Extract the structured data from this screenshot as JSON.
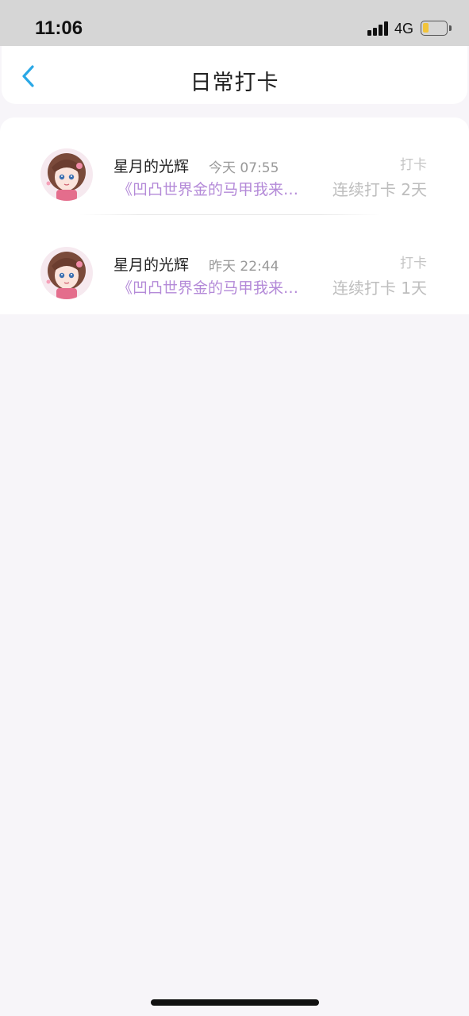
{
  "status_bar": {
    "time": "11:06",
    "network": "4G",
    "battery_level": 0.25,
    "battery_color": "#f2c43a"
  },
  "nav": {
    "back_icon": "chevron-left-icon",
    "title": "日常打卡",
    "accent": "#2aa8e6"
  },
  "checkins": [
    {
      "user_name": "星月的光辉",
      "time": "今天 07:55",
      "action": "打卡",
      "book_title": "《凹凸世界金的马甲我来…",
      "streak": "连续打卡 2天"
    },
    {
      "user_name": "星月的光辉",
      "time": "昨天 22:44",
      "action": "打卡",
      "book_title": "《凹凸世界金的马甲我来…",
      "streak": "连续打卡 1天"
    }
  ],
  "colors": {
    "book_title": "#b48ad8",
    "background": "#f7f5f9"
  }
}
